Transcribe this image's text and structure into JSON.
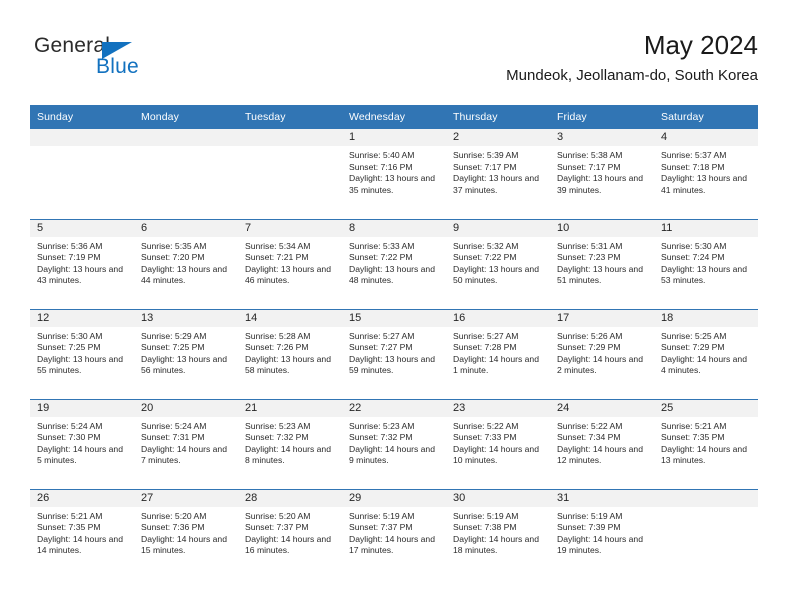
{
  "logo": {
    "word_one": "General",
    "word_two": "Blue",
    "triangle_icon": "triangle-icon",
    "brand_color": "#1271BF"
  },
  "header": {
    "title": "May 2024",
    "subtitle": "Mundeok, Jeollanam-do, South Korea"
  },
  "theme": {
    "header_blue": "#3175B4",
    "daynum_gray": "#F2F2F2",
    "text": "#2b2b2b"
  },
  "weekdays": [
    "Sunday",
    "Monday",
    "Tuesday",
    "Wednesday",
    "Thursday",
    "Friday",
    "Saturday"
  ],
  "labels": {
    "sunrise": "Sunrise:",
    "sunset": "Sunset:",
    "daylight": "Daylight:"
  },
  "weeks": [
    [
      {
        "day": "",
        "blank": true
      },
      {
        "day": "",
        "blank": true
      },
      {
        "day": "",
        "blank": true
      },
      {
        "day": "1",
        "sunrise": "Sunrise: 5:40 AM",
        "sunset": "Sunset: 7:16 PM",
        "daylight": "Daylight: 13 hours and 35 minutes."
      },
      {
        "day": "2",
        "sunrise": "Sunrise: 5:39 AM",
        "sunset": "Sunset: 7:17 PM",
        "daylight": "Daylight: 13 hours and 37 minutes."
      },
      {
        "day": "3",
        "sunrise": "Sunrise: 5:38 AM",
        "sunset": "Sunset: 7:17 PM",
        "daylight": "Daylight: 13 hours and 39 minutes."
      },
      {
        "day": "4",
        "sunrise": "Sunrise: 5:37 AM",
        "sunset": "Sunset: 7:18 PM",
        "daylight": "Daylight: 13 hours and 41 minutes."
      }
    ],
    [
      {
        "day": "5",
        "sunrise": "Sunrise: 5:36 AM",
        "sunset": "Sunset: 7:19 PM",
        "daylight": "Daylight: 13 hours and 43 minutes."
      },
      {
        "day": "6",
        "sunrise": "Sunrise: 5:35 AM",
        "sunset": "Sunset: 7:20 PM",
        "daylight": "Daylight: 13 hours and 44 minutes."
      },
      {
        "day": "7",
        "sunrise": "Sunrise: 5:34 AM",
        "sunset": "Sunset: 7:21 PM",
        "daylight": "Daylight: 13 hours and 46 minutes."
      },
      {
        "day": "8",
        "sunrise": "Sunrise: 5:33 AM",
        "sunset": "Sunset: 7:22 PM",
        "daylight": "Daylight: 13 hours and 48 minutes."
      },
      {
        "day": "9",
        "sunrise": "Sunrise: 5:32 AM",
        "sunset": "Sunset: 7:22 PM",
        "daylight": "Daylight: 13 hours and 50 minutes."
      },
      {
        "day": "10",
        "sunrise": "Sunrise: 5:31 AM",
        "sunset": "Sunset: 7:23 PM",
        "daylight": "Daylight: 13 hours and 51 minutes."
      },
      {
        "day": "11",
        "sunrise": "Sunrise: 5:30 AM",
        "sunset": "Sunset: 7:24 PM",
        "daylight": "Daylight: 13 hours and 53 minutes."
      }
    ],
    [
      {
        "day": "12",
        "sunrise": "Sunrise: 5:30 AM",
        "sunset": "Sunset: 7:25 PM",
        "daylight": "Daylight: 13 hours and 55 minutes."
      },
      {
        "day": "13",
        "sunrise": "Sunrise: 5:29 AM",
        "sunset": "Sunset: 7:25 PM",
        "daylight": "Daylight: 13 hours and 56 minutes."
      },
      {
        "day": "14",
        "sunrise": "Sunrise: 5:28 AM",
        "sunset": "Sunset: 7:26 PM",
        "daylight": "Daylight: 13 hours and 58 minutes."
      },
      {
        "day": "15",
        "sunrise": "Sunrise: 5:27 AM",
        "sunset": "Sunset: 7:27 PM",
        "daylight": "Daylight: 13 hours and 59 minutes."
      },
      {
        "day": "16",
        "sunrise": "Sunrise: 5:27 AM",
        "sunset": "Sunset: 7:28 PM",
        "daylight": "Daylight: 14 hours and 1 minute."
      },
      {
        "day": "17",
        "sunrise": "Sunrise: 5:26 AM",
        "sunset": "Sunset: 7:29 PM",
        "daylight": "Daylight: 14 hours and 2 minutes."
      },
      {
        "day": "18",
        "sunrise": "Sunrise: 5:25 AM",
        "sunset": "Sunset: 7:29 PM",
        "daylight": "Daylight: 14 hours and 4 minutes."
      }
    ],
    [
      {
        "day": "19",
        "sunrise": "Sunrise: 5:24 AM",
        "sunset": "Sunset: 7:30 PM",
        "daylight": "Daylight: 14 hours and 5 minutes."
      },
      {
        "day": "20",
        "sunrise": "Sunrise: 5:24 AM",
        "sunset": "Sunset: 7:31 PM",
        "daylight": "Daylight: 14 hours and 7 minutes."
      },
      {
        "day": "21",
        "sunrise": "Sunrise: 5:23 AM",
        "sunset": "Sunset: 7:32 PM",
        "daylight": "Daylight: 14 hours and 8 minutes."
      },
      {
        "day": "22",
        "sunrise": "Sunrise: 5:23 AM",
        "sunset": "Sunset: 7:32 PM",
        "daylight": "Daylight: 14 hours and 9 minutes."
      },
      {
        "day": "23",
        "sunrise": "Sunrise: 5:22 AM",
        "sunset": "Sunset: 7:33 PM",
        "daylight": "Daylight: 14 hours and 10 minutes."
      },
      {
        "day": "24",
        "sunrise": "Sunrise: 5:22 AM",
        "sunset": "Sunset: 7:34 PM",
        "daylight": "Daylight: 14 hours and 12 minutes."
      },
      {
        "day": "25",
        "sunrise": "Sunrise: 5:21 AM",
        "sunset": "Sunset: 7:35 PM",
        "daylight": "Daylight: 14 hours and 13 minutes."
      }
    ],
    [
      {
        "day": "26",
        "sunrise": "Sunrise: 5:21 AM",
        "sunset": "Sunset: 7:35 PM",
        "daylight": "Daylight: 14 hours and 14 minutes."
      },
      {
        "day": "27",
        "sunrise": "Sunrise: 5:20 AM",
        "sunset": "Sunset: 7:36 PM",
        "daylight": "Daylight: 14 hours and 15 minutes."
      },
      {
        "day": "28",
        "sunrise": "Sunrise: 5:20 AM",
        "sunset": "Sunset: 7:37 PM",
        "daylight": "Daylight: 14 hours and 16 minutes."
      },
      {
        "day": "29",
        "sunrise": "Sunrise: 5:19 AM",
        "sunset": "Sunset: 7:37 PM",
        "daylight": "Daylight: 14 hours and 17 minutes."
      },
      {
        "day": "30",
        "sunrise": "Sunrise: 5:19 AM",
        "sunset": "Sunset: 7:38 PM",
        "daylight": "Daylight: 14 hours and 18 minutes."
      },
      {
        "day": "31",
        "sunrise": "Sunrise: 5:19 AM",
        "sunset": "Sunset: 7:39 PM",
        "daylight": "Daylight: 14 hours and 19 minutes."
      },
      {
        "day": "",
        "blank": true
      }
    ]
  ]
}
